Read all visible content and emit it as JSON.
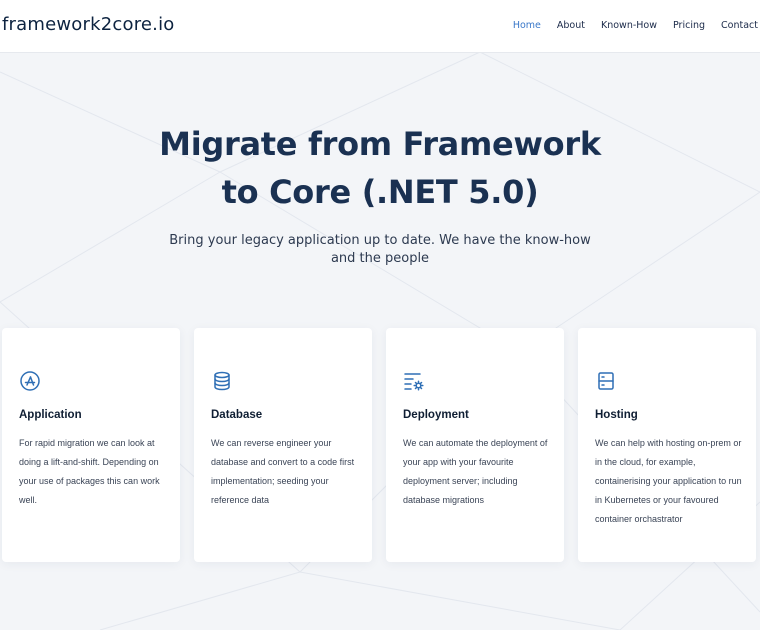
{
  "nav": {
    "brand": "framework2core.io",
    "links": [
      "Home",
      "About",
      "Known-How",
      "Pricing",
      "Contact"
    ],
    "active": "Home"
  },
  "hero": {
    "title_line1": "Migrate from Framework",
    "title_line2": "to Core (.NET 5.0)",
    "subtitle": "Bring your legacy application up to date. We have the know-how and the people"
  },
  "cards": [
    {
      "icon": "app-icon",
      "title": "Application",
      "text": "For rapid migration we can look at doing a lift-and-shift. Depending on your use of packages this can work well."
    },
    {
      "icon": "database-icon",
      "title": "Database",
      "text": "We can reverse engineer your database and convert to a code first implementation; seeding your reference data"
    },
    {
      "icon": "deployment-settings-icon",
      "title": "Deployment",
      "text": "We can automate the deployment of your app with your favourite deployment server; including database migrations"
    },
    {
      "icon": "server-icon",
      "title": "Hosting",
      "text": "We can help with hosting on-prem or in the cloud, for example, containerising your application to run in Kubernetes or your favoured container orchastrator"
    }
  ],
  "colors": {
    "accent": "#3a78c9",
    "heading": "#1a3152",
    "icon": "#2f6fb5",
    "background": "#f3f5f8"
  }
}
